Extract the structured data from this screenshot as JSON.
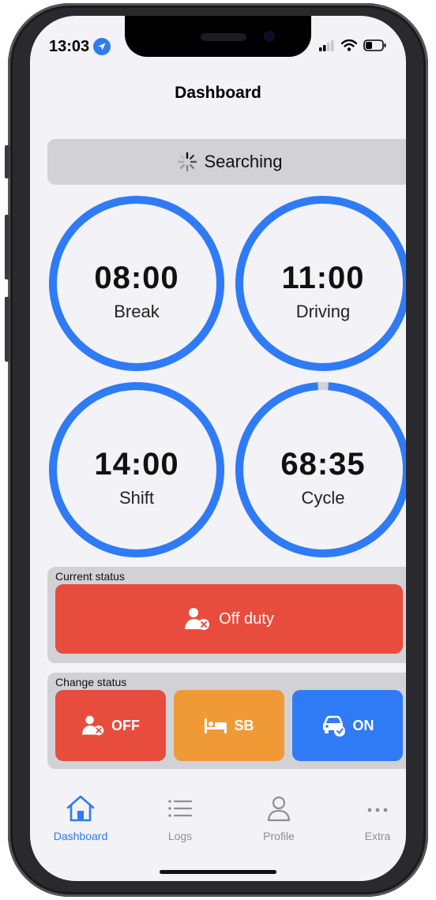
{
  "status_bar": {
    "time": "13:03"
  },
  "header": {
    "title": "Dashboard"
  },
  "search": {
    "label": "Searching"
  },
  "timers": [
    {
      "value": "08:00",
      "label": "Break",
      "progress": 1.0
    },
    {
      "value": "11:00",
      "label": "Driving",
      "progress": 1.0
    },
    {
      "value": "14:00",
      "label": "Shift",
      "progress": 1.0
    },
    {
      "value": "68:35",
      "label": "Cycle",
      "progress": 0.98
    }
  ],
  "current_status": {
    "title": "Current status",
    "value": "Off duty",
    "color": "#e84c3d"
  },
  "change_status": {
    "title": "Change status",
    "buttons": [
      {
        "label": "OFF",
        "color": "#e84c3d"
      },
      {
        "label": "SB",
        "color": "#f09a36"
      },
      {
        "label": "ON",
        "color": "#2f7bf5"
      }
    ]
  },
  "tabs": [
    {
      "label": "Dashboard",
      "active": true
    },
    {
      "label": "Logs"
    },
    {
      "label": "Profile"
    },
    {
      "label": "Extra"
    }
  ],
  "colors": {
    "accent": "#2f7bf5",
    "inactive": "#8e8e93"
  }
}
